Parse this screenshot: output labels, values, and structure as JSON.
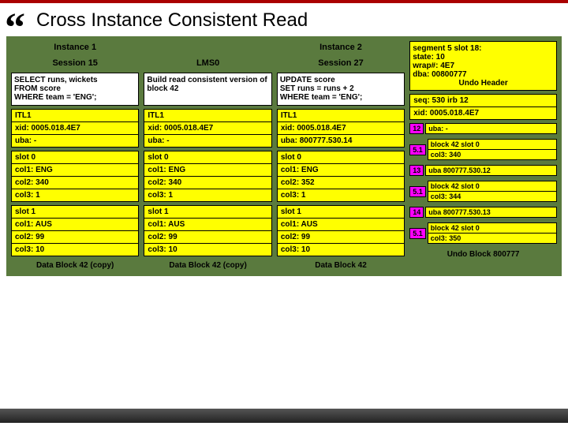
{
  "title": "Cross Instance Consistent Read",
  "inst1": "Instance 1",
  "inst2": "Instance 2",
  "s15": "Session 15",
  "lms": "LMS0",
  "s27": "Session 27",
  "q1": "SELECT runs, wickets\nFROM score\nWHERE team = 'ENG';",
  "q2": "Build read consistent version of block 42",
  "q3": "UPDATE score\nSET runs = runs + 2\nWHERE team = 'ENG';",
  "seg": {
    "l1": "segment 5 slot 18:",
    "l2": "state: 10",
    "l3": "wrap#: 4E7",
    "l4": "dba: 00800777",
    "cap": "Undo Header"
  },
  "itl": "ITL1",
  "xid": "xid: 0005.018.4E7",
  "ubaDash": "uba: -",
  "uba3": "uba: 800777.530.14",
  "seq": "seq: 530 irb 12",
  "s0": "slot 0",
  "s1": "slot 1",
  "c1e": "col1: ENG",
  "c2a": "col2: 340",
  "c2b": "col2: 352",
  "c3one": "col3: 1",
  "c1a": "col1: AUS",
  "c2n": "col2: 99",
  "c3t": "col3: 10",
  "capA": "Data Block 42 (copy)",
  "capB": "Data Block 42",
  "capU": "Undo Block 800777",
  "t12": "12",
  "t13": "13",
  "t14": "14",
  "t51": "5.1",
  "u1a": "block 42 slot 0",
  "u1b": "col3: 340",
  "u2": "uba 800777.530.12",
  "u3a": "block 42 slot 0",
  "u3b": "col3: 344",
  "u4": "uba 800777.530.13",
  "u5a": "block 42 slot 0",
  "u5b": "col3: 350"
}
